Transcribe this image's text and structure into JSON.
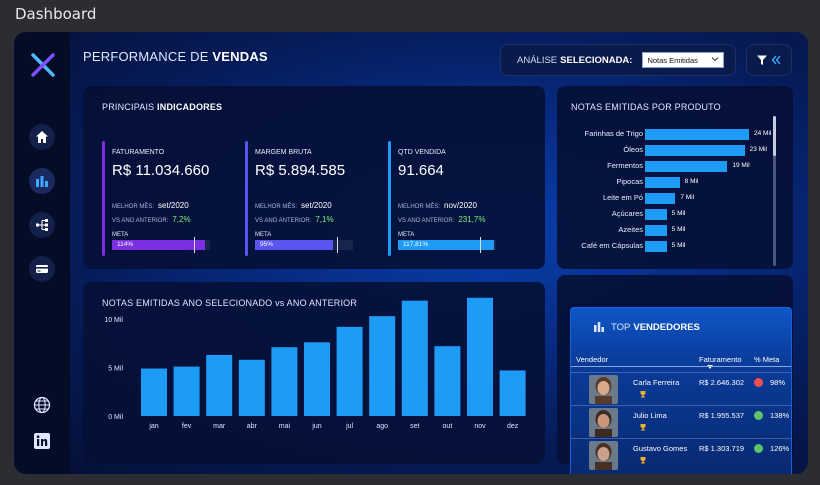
{
  "window": {
    "title": "Dashboard"
  },
  "header": {
    "title_prefix": "PERFORMANCE DE",
    "title_bold": "VENDAS",
    "analysis_label_prefix": "ANÁLISE",
    "analysis_label_bold": "SELECIONADA:",
    "analysis_selected": "Notas Emitidas"
  },
  "sidebar": {
    "items": [
      {
        "icon": "home-icon"
      },
      {
        "icon": "bar-chart-icon",
        "active": true
      },
      {
        "icon": "hierarchy-icon"
      },
      {
        "icon": "credit-card-icon"
      }
    ],
    "footer": [
      {
        "icon": "globe-icon"
      },
      {
        "icon": "linkedin-icon"
      }
    ]
  },
  "indicators": {
    "title_prefix": "PRINCIPAIS",
    "title_bold": "INDICADORES",
    "best_label": "MELHOR MÊS:",
    "prev_label": "VS ANO ANTERIOR:",
    "meta_label": "META",
    "cards": [
      {
        "label": "FATURAMENTO",
        "value": "R$ 11.034.660",
        "best": "set/2020",
        "prev": "7,2%",
        "meta_pct": "114%",
        "meta_fraction": 1.14,
        "color": "#7b2fe0"
      },
      {
        "label": "MARGEM BRUTA",
        "value": "R$ 5.894.585",
        "best": "set/2020",
        "prev": "7,1%",
        "meta_pct": "95%",
        "meta_fraction": 0.95,
        "color": "#5a55f0"
      },
      {
        "label": "QTD VENDIDA",
        "value": "91.664",
        "best": "nov/2020",
        "prev": "231,7%",
        "meta_pct": "117,81%",
        "meta_fraction": 1.1781,
        "color": "#1e9bf5"
      }
    ]
  },
  "product_panel": {
    "title": "NOTAS EMITIDAS POR PRODUTO"
  },
  "sellers": {
    "title_prefix": "TOP",
    "title_bold": "VENDEDORES",
    "col_vendedor": "Vendedor",
    "col_faturamento": "Faturamento",
    "col_meta": "% Meta",
    "rows": [
      {
        "name": "Carla Ferreira",
        "faturamento": "R$ 2.646.302",
        "meta": "98%",
        "status_color": "#f05050"
      },
      {
        "name": "Julio Lima",
        "faturamento": "R$ 1.955.537",
        "meta": "138%",
        "status_color": "#5cc46a"
      },
      {
        "name": "Gustavo Gomes",
        "faturamento": "R$ 1.303.719",
        "meta": "126%",
        "status_color": "#5cc46a"
      }
    ]
  },
  "year_panel": {
    "title": "NOTAS EMITIDAS ANO SELECIONADO vs ANO ANTERIOR"
  },
  "chart_data": [
    {
      "type": "bar",
      "orientation": "horizontal",
      "categories": [
        "Farinhas de Trigo",
        "Óleos",
        "Fermentos",
        "Pipocas",
        "Leite em Pó",
        "Açúcares",
        "Azeites",
        "Café em Cápsulas"
      ],
      "values": [
        24,
        23,
        19,
        8,
        7,
        5,
        5,
        5
      ],
      "value_labels": [
        "24 Mil",
        "23 Mil",
        "19 Mil",
        "8 Mil",
        "7 Mil",
        "5 Mil",
        "5 Mil",
        "5 Mil"
      ],
      "color": "#1e9bf5"
    },
    {
      "type": "bar",
      "categories": [
        "jan",
        "fev",
        "mar",
        "abr",
        "mai",
        "jun",
        "jul",
        "ago",
        "set",
        "out",
        "nov",
        "dez"
      ],
      "values": [
        4.9,
        5.1,
        6.3,
        5.8,
        7.1,
        7.6,
        9.2,
        10.3,
        11.9,
        7.2,
        12.2,
        4.7
      ],
      "yticks": [
        "0 Mil",
        "5 Mil",
        "10 Mil"
      ],
      "ylim": [
        0,
        13
      ],
      "color": "#1e9bf5"
    }
  ],
  "colors": {
    "accent": "#1e9bf5",
    "background": "#061a55",
    "panel": "#051037"
  }
}
